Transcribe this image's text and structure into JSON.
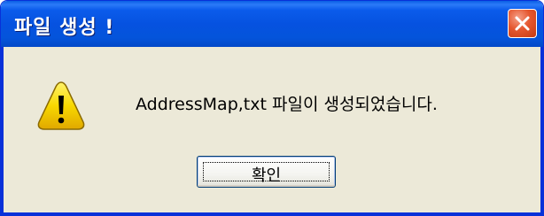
{
  "dialog": {
    "title": "파일 생성 !",
    "message": "AddressMap,txt 파일이 생성되었습니다.",
    "ok_label": "확인",
    "icon": "warning-icon",
    "close_icon": "close-icon"
  },
  "colors": {
    "titlebar": "#0454DB",
    "frame": "#0831D9",
    "body": "#ECE9D8",
    "close_button": "#E5572F",
    "warning_fill": "#F8D800"
  }
}
